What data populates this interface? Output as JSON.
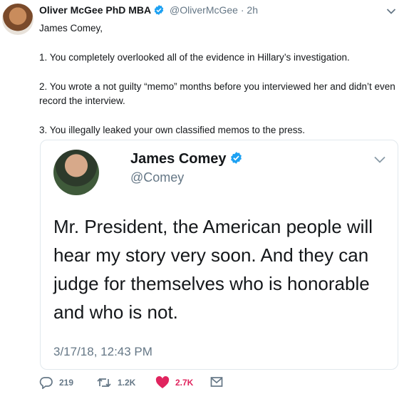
{
  "tweet": {
    "author_name": "Oliver McGee PhD MBA",
    "handle": "@OliverMcGee",
    "separator": "·",
    "time": "2h",
    "lines": [
      "James Comey,",
      "1. You completely overlooked all of the evidence in Hillary’s investigation.",
      "2. You wrote a not guilty “memo” months before you interviewed her and didn’t even record the interview.",
      "3. You illegally leaked your own classified memos to the press."
    ]
  },
  "quoted": {
    "author_name": "James Comey",
    "handle": "@Comey",
    "text": "Mr. President, the American people will hear my story very soon. And they can judge for themselves who is honorable and who is not.",
    "timestamp": "3/17/18, 12:43 PM"
  },
  "actions": {
    "replies": "219",
    "retweets": "1.2K",
    "likes": "2.7K"
  },
  "colors": {
    "verified": "#1da1f2",
    "like": "#e0245e",
    "muted": "#657786",
    "border": "#e1e8ed"
  },
  "icons": [
    "verified-badge-icon",
    "chevron-down-icon",
    "reply-icon",
    "retweet-icon",
    "heart-icon",
    "message-icon"
  ]
}
